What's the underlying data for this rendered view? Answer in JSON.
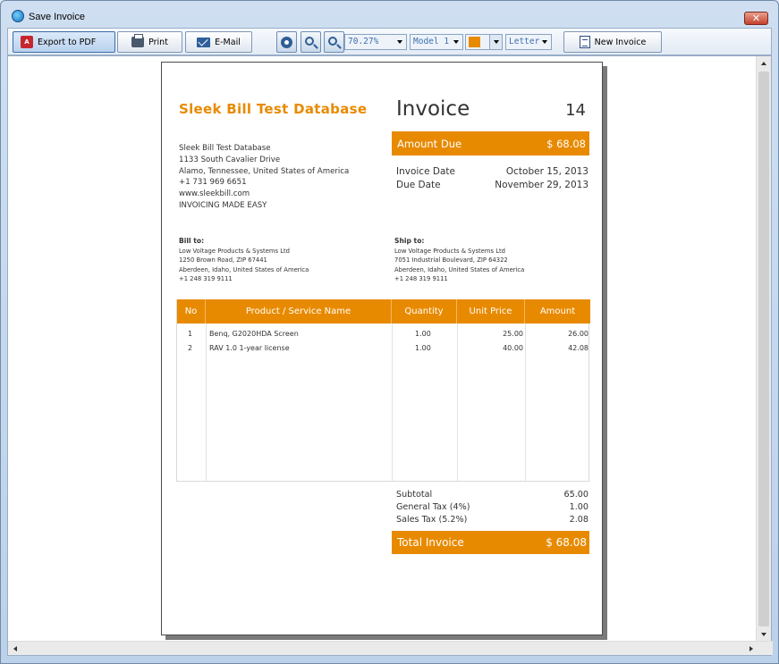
{
  "window": {
    "title": "Save Invoice",
    "close_label": "✕"
  },
  "toolbar": {
    "export_pdf": "Export to PDF",
    "print": "Print",
    "email": "E-Mail",
    "zoom": "70.27%",
    "model": "Model 1",
    "page_size": "Letter",
    "new_invoice": "New Invoice",
    "accent_color": "#e88a00"
  },
  "invoice": {
    "company_name": "Sleek Bill Test Database",
    "company_lines": [
      "Sleek Bill Test Database",
      "1133 South Cavalier Drive",
      "Alamo, Tennessee, United States of America",
      "+1 731 969 6651",
      "www.sleekbill.com",
      "INVOICING MADE EASY"
    ],
    "title": "Invoice",
    "number": "14",
    "amount_due_label": "Amount Due",
    "amount_due_value": "$ 68.08",
    "invoice_date_label": "Invoice Date",
    "invoice_date_value": "October 15, 2013",
    "due_date_label": "Due Date",
    "due_date_value": "November 29, 2013",
    "bill_to": {
      "label": "Bill to:",
      "lines": [
        "Low Voltage Products & Systems Ltd",
        "1250 Brown Road, ZIP 67441",
        "Aberdeen, Idaho, United States of America",
        "+1 248 319 9111"
      ]
    },
    "ship_to": {
      "label": "Ship to:",
      "lines": [
        "Low Voltage Products & Systems Ltd",
        "7051 Industrial Boulevard, ZIP 64322",
        "Aberdeen, Idaho, United States of America",
        "+1 248 319 9111"
      ]
    },
    "columns": [
      "No",
      "Product / Service Name",
      "Quantity",
      "Unit Price",
      "Amount"
    ],
    "items": [
      {
        "no": "1",
        "name": "Benq, G2020HDA Screen",
        "qty": "1.00",
        "price": "25.00",
        "amount": "26.00"
      },
      {
        "no": "2",
        "name": "RAV 1.0 1-year license",
        "qty": "1.00",
        "price": "40.00",
        "amount": "42.08"
      }
    ],
    "subtotal_label": "Subtotal",
    "subtotal_value": "65.00",
    "tax1_label": "General Tax (4%)",
    "tax1_value": "1.00",
    "tax2_label": "Sales Tax (5.2%)",
    "tax2_value": "2.08",
    "total_label": "Total Invoice",
    "total_value": "$ 68.08"
  }
}
